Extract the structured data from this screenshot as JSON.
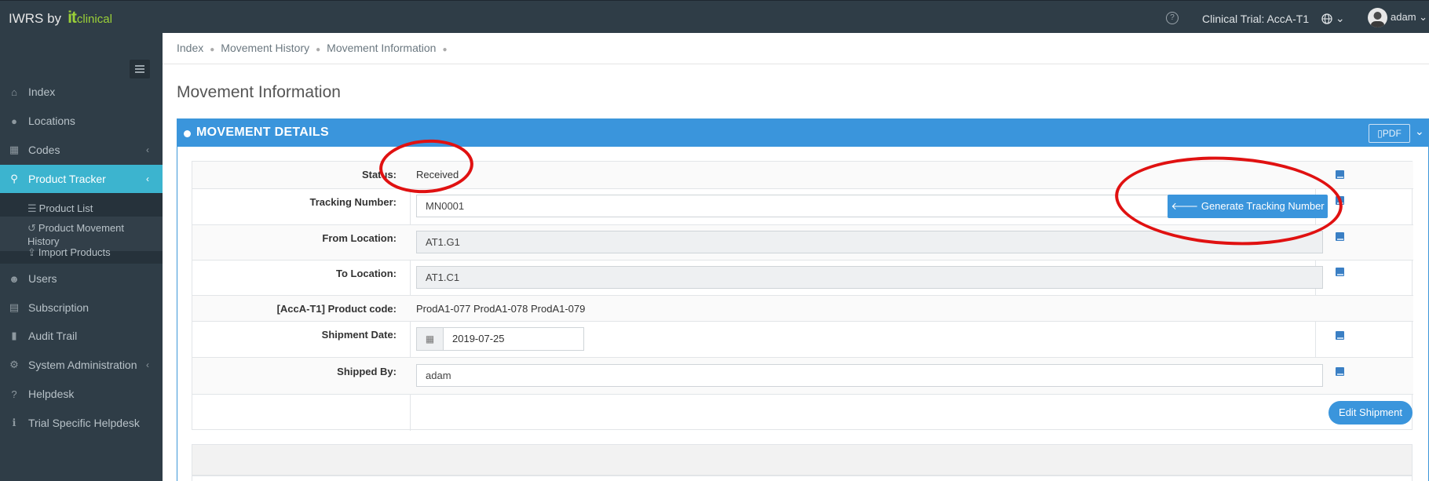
{
  "topbar": {
    "brand_prefix": "IWRS by",
    "brand_it": "it",
    "brand_clinical": "clinical",
    "help_glyph": "?",
    "trial_label": "Clinical Trial: AccA-T1",
    "language_caret": "⌄",
    "username": "adam",
    "user_caret": "⌄"
  },
  "sidebar": {
    "items": [
      {
        "label": "Index",
        "icon": "home-icon"
      },
      {
        "label": "Locations",
        "icon": "globe-icon"
      },
      {
        "label": "Codes",
        "icon": "grid-icon"
      },
      {
        "label": "Product Tracker",
        "icon": "map-marker-icon"
      },
      {
        "label": "Users",
        "icon": "users-icon"
      },
      {
        "label": "Subscription",
        "icon": "calendar-icon"
      },
      {
        "label": "Audit Trail",
        "icon": "book-icon"
      },
      {
        "label": "System Administration",
        "icon": "cogs-icon"
      },
      {
        "label": "Helpdesk",
        "icon": "question-icon"
      },
      {
        "label": "Trial Specific Helpdesk",
        "icon": "info-icon"
      }
    ],
    "sub_items": [
      {
        "label": "Product List",
        "icon": "list-icon"
      },
      {
        "label": "Product Movement History",
        "icon": "history-icon"
      },
      {
        "label": "Import Products",
        "icon": "upload-icon"
      }
    ]
  },
  "breadcrumb": [
    "Index",
    "Movement History",
    "Movement Information"
  ],
  "page_title": "Movement Information",
  "panel": {
    "title": "MOVEMENT DETAILS",
    "pdf_label": "PDF"
  },
  "fields": {
    "status_label": "Status:",
    "status_value": "Received",
    "tracking_label": "Tracking Number:",
    "tracking_value": "MN0001",
    "generate_label": "Generate Tracking Number",
    "from_label": "From Location:",
    "from_value": "AT1.G1",
    "to_label": "To Location:",
    "to_value": "AT1.C1",
    "product_code_label": "[AccA-T1] Product code:",
    "product_code_value": "ProdA1-077 ProdA1-078 ProdA1-079",
    "shipment_date_label": "Shipment Date:",
    "shipment_date_value": "2019-07-25",
    "shipped_by_label": "Shipped By:",
    "shipped_by_value": "adam"
  },
  "edit_shipment_label": "Edit Shipment",
  "colors": {
    "topbar": "#2f3d47",
    "active_nav": "#3cb4cf",
    "panel_header": "#3a95dc",
    "annotation": "#e01111"
  }
}
